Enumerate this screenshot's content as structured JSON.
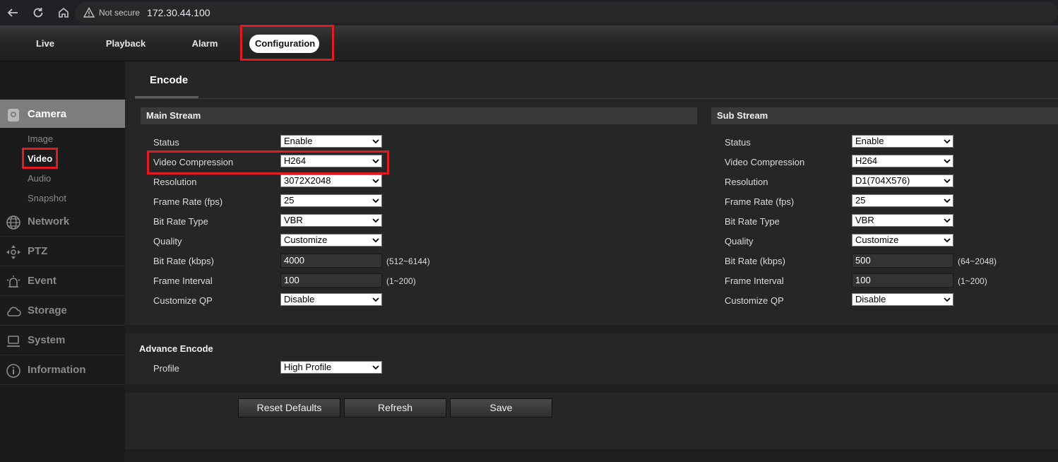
{
  "browser": {
    "security_label": "Not secure",
    "url": "172.30.44.100"
  },
  "topnav": {
    "tabs": [
      {
        "label": "Live"
      },
      {
        "label": "Playback"
      },
      {
        "label": "Alarm"
      },
      {
        "label": "Configuration",
        "active": true
      }
    ]
  },
  "sidebar": {
    "camera": {
      "label": "Camera",
      "icon": "camera-icon",
      "subitems": [
        "Image",
        "Video",
        "Audio",
        "Snapshot"
      ],
      "active_sub": "Video"
    },
    "items": [
      {
        "label": "Network",
        "icon": "globe-icon"
      },
      {
        "label": "PTZ",
        "icon": "ptz-icon"
      },
      {
        "label": "Event",
        "icon": "alarm-icon"
      },
      {
        "label": "Storage",
        "icon": "cloud-icon"
      },
      {
        "label": "System",
        "icon": "laptop-icon"
      },
      {
        "label": "Information",
        "icon": "info-icon"
      }
    ]
  },
  "page": {
    "tab_label": "Encode"
  },
  "main_stream": {
    "title": "Main Stream",
    "labels": {
      "status": "Status",
      "video_compression": "Video Compression",
      "resolution": "Resolution",
      "frame_rate": "Frame Rate (fps)",
      "bit_rate_type": "Bit Rate Type",
      "quality": "Quality",
      "bit_rate": "Bit Rate (kbps)",
      "frame_interval": "Frame Interval",
      "customize_qp": "Customize QP"
    },
    "values": {
      "status": "Enable",
      "video_compression": "H264",
      "resolution": "3072X2048",
      "frame_rate": "25",
      "bit_rate_type": "VBR",
      "quality": "Customize",
      "bit_rate": "4000",
      "frame_interval": "100",
      "customize_qp": "Disable"
    },
    "ranges": {
      "bit_rate": "(512~6144)",
      "frame_interval": "(1~200)"
    }
  },
  "sub_stream": {
    "title": "Sub Stream",
    "labels": {
      "status": "Status",
      "video_compression": "Video Compression",
      "resolution": "Resolution",
      "frame_rate": "Frame Rate (fps)",
      "bit_rate_type": "Bit Rate Type",
      "quality": "Quality",
      "bit_rate": "Bit Rate (kbps)",
      "frame_interval": "Frame Interval",
      "customize_qp": "Customize QP"
    },
    "values": {
      "status": "Enable",
      "video_compression": "H264",
      "resolution": "D1(704X576)",
      "frame_rate": "25",
      "bit_rate_type": "VBR",
      "quality": "Customize",
      "bit_rate": "500",
      "frame_interval": "100",
      "customize_qp": "Disable"
    },
    "ranges": {
      "bit_rate": "(64~2048)",
      "frame_interval": "(1~200)"
    }
  },
  "advance": {
    "title": "Advance Encode",
    "profile_label": "Profile",
    "profile_value": "High Profile"
  },
  "buttons": {
    "reset": "Reset Defaults",
    "refresh": "Refresh",
    "save": "Save"
  },
  "colors": {
    "highlight": "#e01b24",
    "active_sidebar": "#7d7d7d"
  }
}
